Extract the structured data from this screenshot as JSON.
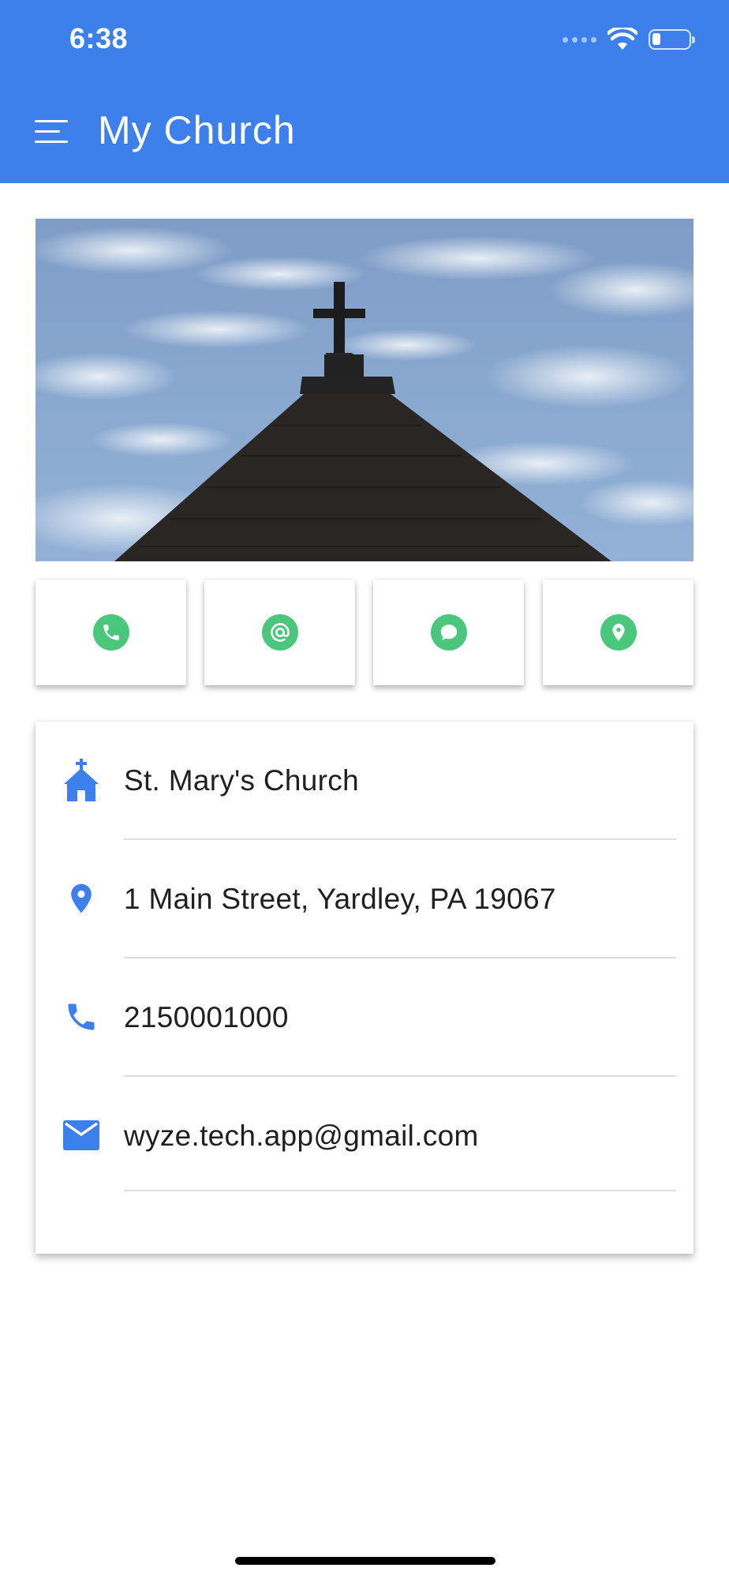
{
  "status_bar": {
    "time": "6:38"
  },
  "header": {
    "title": "My Church",
    "menu_icon": "hamburger-menu-icon"
  },
  "hero": {
    "icon": "church-steeple-photo"
  },
  "actions": [
    {
      "id": "call",
      "icon": "phone-icon"
    },
    {
      "id": "email",
      "icon": "at-sign-icon"
    },
    {
      "id": "message",
      "icon": "chat-bubble-icon"
    },
    {
      "id": "map",
      "icon": "location-pin-icon"
    }
  ],
  "info": {
    "name": "St. Mary's Church",
    "address": "1 Main Street, Yardley, PA 19067",
    "phone": "2150001000",
    "email": "wyze.tech.app@gmail.com"
  },
  "colors": {
    "header_bg": "#3d80eb",
    "action_icon_bg": "#4bc77d",
    "info_icon": "#3d80eb"
  }
}
